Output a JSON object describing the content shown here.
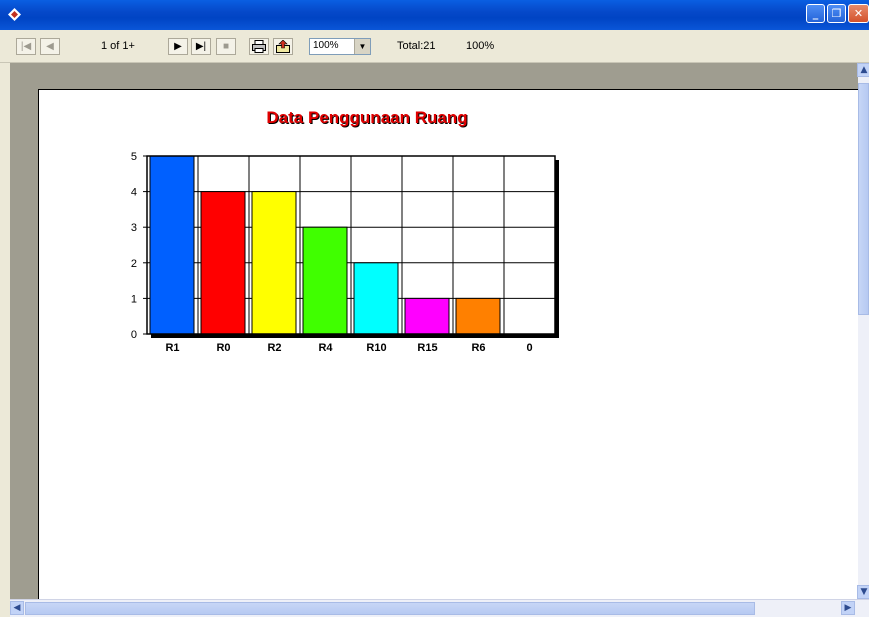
{
  "window": {
    "minimize_glyph": "_",
    "restore_glyph": "❐",
    "close_glyph": "✕"
  },
  "toolbar": {
    "first_glyph": "|◀",
    "prev_glyph": "◀",
    "page_indicator": "1 of 1+",
    "next_glyph": "▶",
    "last_glyph": "▶|",
    "stop_glyph": "■",
    "zoom_value": "100%",
    "total_label": "Total:21",
    "zoom_label": "100%"
  },
  "scrollbar": {
    "up_glyph": "▲",
    "down_glyph": "▼",
    "left_glyph": "◀",
    "right_glyph": "▶"
  },
  "report": {
    "title": "Data Penggunaan Ruang"
  },
  "chart_data": {
    "type": "bar",
    "title": "Data Penggunaan Ruang",
    "categories": [
      "R1",
      "R0",
      "R2",
      "R4",
      "R10",
      "R15",
      "R6",
      "0"
    ],
    "values": [
      5,
      4,
      4,
      3,
      2,
      1,
      1,
      0
    ],
    "colors": [
      "#0060ff",
      "#ff0000",
      "#ffff00",
      "#40ff00",
      "#00ffff",
      "#ff00ff",
      "#ff8000",
      "#ffffff"
    ],
    "y_ticks": [
      "0",
      "1",
      "2",
      "3",
      "4",
      "5"
    ],
    "ylim": [
      0,
      5
    ],
    "grid": true,
    "legend": "none"
  }
}
